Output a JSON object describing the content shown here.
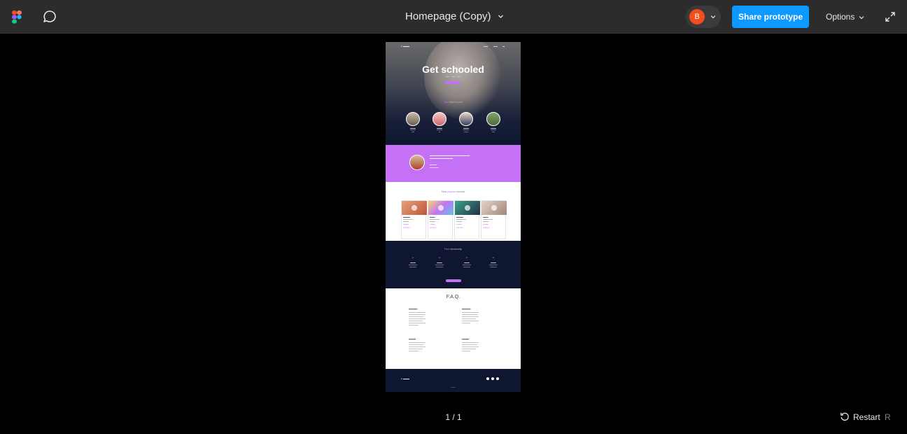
{
  "topbar": {
    "title": "Homepage (Copy)",
    "avatar_initial": "B",
    "share_label": "Share prototype",
    "options_label": "Options"
  },
  "prototype": {
    "hero_title": "Get schooled",
    "tutors_heading_hl": "your",
    "tutors_heading_rest": " tutor for you"
  },
  "tutorials": {
    "heading_plain": "Most ",
    "heading_hl": "popular",
    "heading_rest": " tutorials"
  },
  "mentorship": {
    "heading_hl": "Free",
    "heading_rest": " mentorship"
  },
  "faq": {
    "title": "F.A.Q."
  },
  "pager": {
    "text": "1 / 1"
  },
  "restart": {
    "label": "Restart",
    "shortcut": "R"
  },
  "colors": {
    "accent": "#0d99ff",
    "purple": "#c471f5",
    "navy": "#0e1630"
  }
}
